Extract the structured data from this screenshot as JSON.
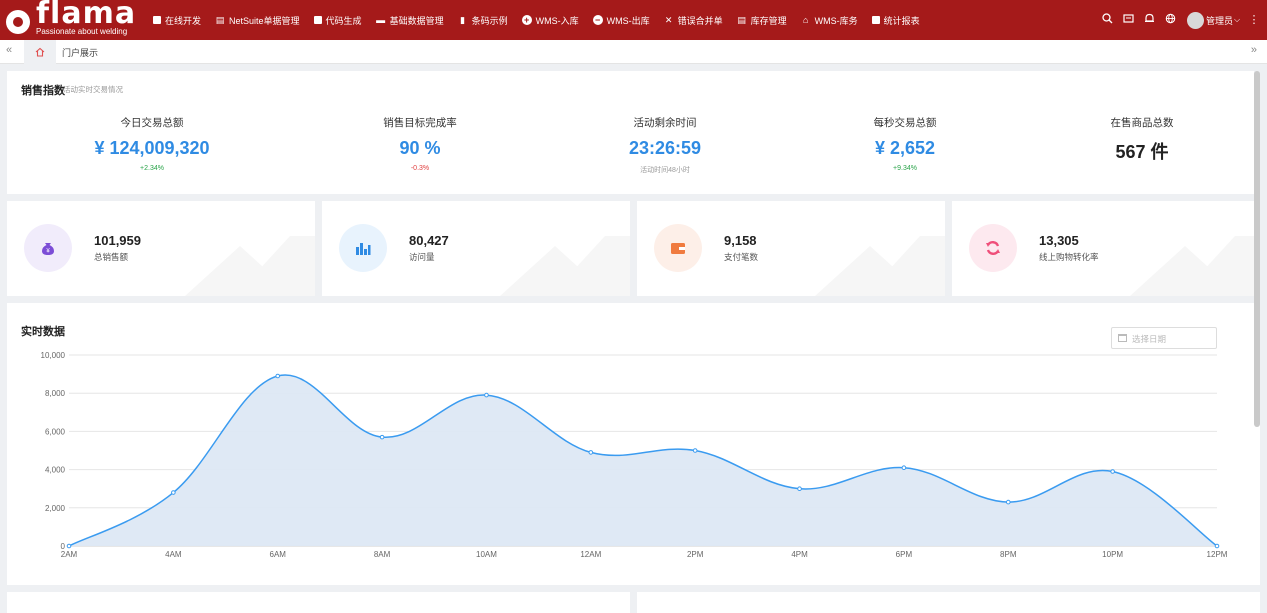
{
  "brand": {
    "logo_text": "flama",
    "tagline": "Passionate about welding"
  },
  "nav": [
    {
      "label": "在线开发",
      "icon": "square-icon"
    },
    {
      "label": "NetSuite单据管理",
      "icon": "document-icon"
    },
    {
      "label": "代码生成",
      "icon": "square-icon"
    },
    {
      "label": "基础数据管理",
      "icon": "folder-icon"
    },
    {
      "label": "条码示例",
      "icon": "barcode-icon"
    },
    {
      "label": "WMS-入库",
      "icon": "plus-circle-icon"
    },
    {
      "label": "WMS-出库",
      "icon": "minus-circle-icon"
    },
    {
      "label": "错误合并单",
      "icon": "close-icon"
    },
    {
      "label": "库存管理",
      "icon": "document-icon"
    },
    {
      "label": "WMS-库务",
      "icon": "home-icon"
    },
    {
      "label": "统计报表",
      "icon": "square-icon"
    }
  ],
  "user": {
    "name": "管理员"
  },
  "tabs": {
    "portal": "门户展示"
  },
  "sales": {
    "title": "销售指数",
    "subtitle": "活动实时交易情况",
    "kpis": [
      {
        "label": "今日交易总额",
        "value": "¥ 124,009,320",
        "sub": "+2.34%",
        "trend": "up"
      },
      {
        "label": "销售目标完成率",
        "value": "90 %",
        "sub": "-0.3%",
        "trend": "down"
      },
      {
        "label": "活动剩余时间",
        "value": "23:26:59",
        "sub": "活动时间48小时",
        "trend": "neutral"
      },
      {
        "label": "每秒交易总额",
        "value": "¥ 2,652",
        "sub": "+9.34%",
        "trend": "up"
      },
      {
        "label": "在售商品总数",
        "value": "567 件",
        "sub": "",
        "trend": "none"
      }
    ]
  },
  "stats": [
    {
      "value": "101,959",
      "label": "总销售额",
      "icon": "money-bag-icon",
      "color": "#7c4dd6",
      "bg": "#f1ecfb"
    },
    {
      "value": "80,427",
      "label": "访问量",
      "icon": "bar-chart-icon",
      "color": "#2f8be3",
      "bg": "#e8f3fd"
    },
    {
      "value": "9,158",
      "label": "支付笔数",
      "icon": "wallet-icon",
      "color": "#f07b3f",
      "bg": "#fdefe8"
    },
    {
      "value": "13,305",
      "label": "线上购物转化率",
      "icon": "refresh-icon",
      "color": "#ef4f7a",
      "bg": "#fde9ef"
    }
  ],
  "realtime": {
    "title": "实时数据",
    "date_placeholder": "选择日期"
  },
  "chart_data": {
    "type": "area",
    "title": "实时数据",
    "x": [
      "2AM",
      "4AM",
      "6AM",
      "8AM",
      "10AM",
      "12AM",
      "2PM",
      "4PM",
      "6PM",
      "8PM",
      "10PM",
      "12PM"
    ],
    "values": [
      0,
      2800,
      8900,
      5700,
      7900,
      4900,
      5000,
      3000,
      4100,
      2300,
      3900,
      0
    ],
    "ylim": [
      0,
      10000
    ],
    "yticks": [
      "0",
      "2,000",
      "4,000",
      "6,000",
      "8,000",
      "10,000"
    ],
    "grid": true,
    "line_color": "#3a9bf0",
    "fill_color": "#dde8f4"
  }
}
